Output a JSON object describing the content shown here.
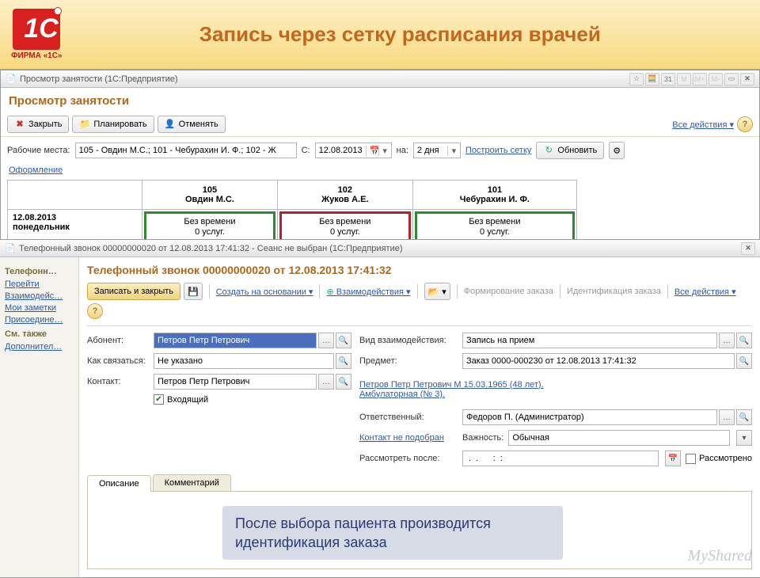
{
  "slide": {
    "logo_sub": "ФИРМА «1С»",
    "title": "Запись через сетку расписания врачей"
  },
  "win1": {
    "bar_title": "Просмотр занятости  (1С:Предприятие)",
    "title": "Просмотр занятости",
    "btn_close": "Закрыть",
    "btn_plan": "Планировать",
    "btn_cancel": "Отменять",
    "all_actions": "Все действия",
    "lbl_places": "Рабочие места:",
    "places_val": "105 - Овдин М.С.; 101 - Чебурахин И. Ф.; 102 - Ж",
    "lbl_from": "С:",
    "date_val": "12.08.2013",
    "lbl_for": "на:",
    "days_val": "2 дня",
    "build_grid": "Построить сетку",
    "refresh": "Обновить",
    "design": "Оформление",
    "cols": [
      {
        "num": "105",
        "name": "Овдин М.С."
      },
      {
        "num": "102",
        "name": "Жуков А.Е."
      },
      {
        "num": "101",
        "name": "Чебурахин И. Ф."
      }
    ],
    "row1_date": "12.08.2013",
    "row1_day": "понедельник",
    "slot_l1": "Без времени",
    "slot_l2": "0 услуг."
  },
  "win2": {
    "bar_title": "Телефонный звонок 00000000020 от 12.08.2013 17:41:32 - Сеанс не выбран  (1С:Предприятие)",
    "form_title": "Телефонный звонок 00000000020 от 12.08.2013 17:41:32",
    "side": {
      "g1": "Телефонн…",
      "i1": "Перейти",
      "i2": "Взаимодейс…",
      "i3": "Мои заметки",
      "i4": "Присоедине…",
      "g2": "См. также",
      "i5": "Дополнител…"
    },
    "tb": {
      "save_close": "Записать и закрыть",
      "create_on": "Создать на основании",
      "interactions": "Взаимодействия",
      "form_order": "Формирование заказа",
      "ident_order": "Идентификация заказа",
      "all_actions": "Все действия"
    },
    "f": {
      "lbl_abonent": "Абонент:",
      "abonent_val": "Петров Петр Петрович",
      "lbl_how": "Как связаться:",
      "how_val": "Не указано",
      "lbl_contact": "Контакт:",
      "contact_val": "Петров Петр Петрович",
      "chk_incoming": "Входящий",
      "lbl_kind": "Вид взаимодействия:",
      "kind_val": "Запись на прием",
      "lbl_subject": "Предмет:",
      "subject_val": "Заказ 0000-000230 от 12.08.2013 17:41:32",
      "patient_link1": "Петров Петр Петрович М 15.03.1965 (48 лет).",
      "patient_link2": "Амбулаторная (№ 3).",
      "lbl_owner": "Ответственный:",
      "owner_val": "Федоров П. (Администратор)",
      "no_contact": "Контакт не подобран",
      "lbl_prio": "Важность:",
      "prio_val": "Обычная",
      "lbl_after": "Рассмотреть после:",
      "after_val": " .  .      :  :",
      "chk_reviewed": "Рассмотрено"
    },
    "tabs": {
      "t1": "Описание",
      "t2": "Комментарий"
    },
    "callout": "После выбора пациента производится идентификация заказа"
  },
  "watermark": "MyShared"
}
